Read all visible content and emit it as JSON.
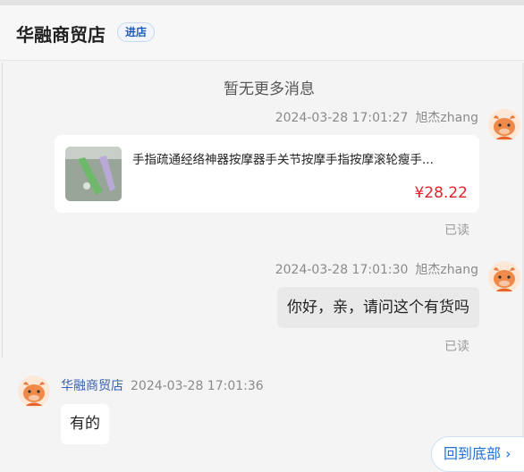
{
  "header": {
    "shop_name": "华融商贸店",
    "enter_label": "进店"
  },
  "no_more": "暂无更多消息",
  "messages": [
    {
      "time": "2024-03-28 17:01:27",
      "sender": "旭杰zhang",
      "product": {
        "title": "手指疏通经络神器按摩器手关节按摩手指按摩滚轮瘦手...",
        "price": "¥28.22"
      },
      "status": "已读"
    },
    {
      "time": "2024-03-28 17:01:30",
      "sender": "旭杰zhang",
      "text": "你好，亲，请问这个有货吗",
      "status": "已读"
    },
    {
      "time": "2024-03-28 17:01:36",
      "sender": "华融商贸店",
      "text": "有的"
    }
  ],
  "back_to_bottom": "回到底部",
  "icons": {
    "avatar": "cartoon-ox-avatar-icon",
    "chevron": "chevron-down-icon"
  },
  "colors": {
    "price": "#e0242b",
    "link": "#1e6fd9",
    "accent": "#1e5bb8"
  }
}
